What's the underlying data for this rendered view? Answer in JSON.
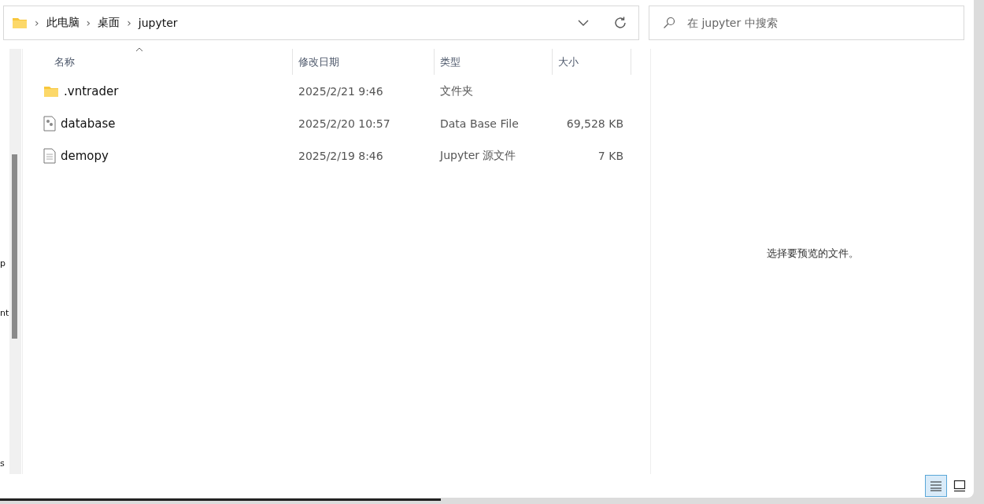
{
  "address_bar": {
    "breadcrumbs": [
      "此电脑",
      "桌面",
      "jupyter"
    ],
    "separator": "›"
  },
  "search": {
    "placeholder": "在 jupyter 中搜索"
  },
  "nav_pane": {
    "items": [
      "p",
      "nt",
      "s"
    ]
  },
  "table": {
    "columns": [
      {
        "label": "名称",
        "sorted": true
      },
      {
        "label": "修改日期",
        "sorted": false
      },
      {
        "label": "类型",
        "sorted": false
      },
      {
        "label": "大小",
        "sorted": false
      }
    ],
    "rows": [
      {
        "kind": "folder",
        "name": ".vntrader",
        "modified": "2025/2/21 9:46",
        "type": "文件夹",
        "size": ""
      },
      {
        "kind": "settings-file",
        "name": "database",
        "modified": "2025/2/20 10:57",
        "type": "Data Base File",
        "size": "69,528 KB"
      },
      {
        "kind": "text-file",
        "name": "demopy",
        "modified": "2025/2/19 8:46",
        "type": "Jupyter 源文件",
        "size": "7 KB"
      }
    ]
  },
  "preview": {
    "message": "选择要预览的文件。"
  },
  "view_buttons": [
    {
      "kind": "details",
      "selected": true
    },
    {
      "kind": "preview",
      "selected": false
    }
  ]
}
